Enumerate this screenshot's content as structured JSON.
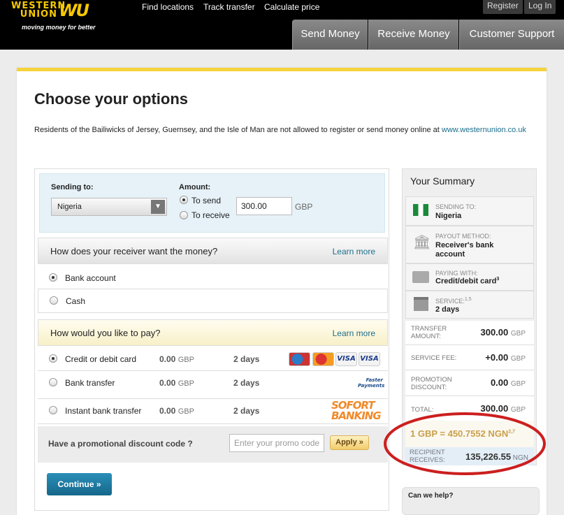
{
  "header": {
    "logo_line1": "WESTERN",
    "logo_line2": "UNION",
    "logo_mark": "WU",
    "tagline": "moving money for better",
    "links": [
      "Find locations",
      "Track transfer",
      "Calculate price"
    ],
    "register": "Register",
    "login": "Log In",
    "tabs": [
      "Send Money",
      "Receive Money",
      "Customer Support"
    ]
  },
  "page": {
    "title": "Choose your options",
    "notice": "Residents of the Bailiwicks of Jersey, Guernsey, and the Isle of Man are not allowed to register or send money online at ",
    "notice_link": "www.westernunion.co.uk"
  },
  "sending": {
    "label": "Sending to:",
    "country": "Nigeria",
    "amount_label": "Amount:",
    "to_send": "To send",
    "to_receive": "To receive",
    "amount": "300.00",
    "currency": "GBP",
    "selected": "To send"
  },
  "receive": {
    "question": "How does your receiver want the money?",
    "learn_more": "Learn more",
    "options": [
      "Bank account",
      "Cash"
    ],
    "selected": "Bank account"
  },
  "pay": {
    "question": "How would you like to pay?",
    "learn_more": "Learn more",
    "selected": "Credit or debit card",
    "options": [
      {
        "label": "Credit or debit card",
        "fee": "0.00",
        "currency": "GBP",
        "days": "2 days",
        "logos": [
          "Maestro",
          "MasterCard",
          "VISA",
          "VISA"
        ]
      },
      {
        "label": "Bank transfer",
        "fee": "0.00",
        "currency": "GBP",
        "days": "2 days",
        "logos": [
          "Faster Payments"
        ]
      },
      {
        "label": "Instant bank transfer",
        "fee": "0.00",
        "currency": "GBP",
        "days": "2 days",
        "logos": [
          "SOFORT BANKING"
        ]
      }
    ]
  },
  "promo": {
    "label": "Have a promotional discount code ?",
    "placeholder": "Enter your promo code",
    "apply": "Apply »"
  },
  "continue": "Continue »",
  "summary": {
    "title": "Your Summary",
    "sending_to_label": "SENDING TO:",
    "sending_to": "Nigeria",
    "payout_label": "PAYOUT METHOD:",
    "payout": "Receiver's bank account",
    "paying_label": "PAYING WITH:",
    "paying": "Credit/debit card",
    "paying_sup": "3",
    "service_label": "SERVICE:",
    "service_sup": "1,5",
    "service": "2 days",
    "transfer_label": "TRANSFER AMOUNT:",
    "transfer": "300.00",
    "fee_label": "SERVICE FEE:",
    "fee": "+0.00",
    "discount_label": "PROMOTION DISCOUNT:",
    "discount": "0.00",
    "total_label": "TOTAL:",
    "total": "300.00",
    "currency": "GBP",
    "rate": "1 GBP = 450.7552 NGN",
    "rate_sup": "2,7",
    "recipient_label": "RECIPIENT RECEIVES:",
    "recipient": "135,226.55",
    "recipient_currency": "NGN"
  },
  "help": {
    "title": "Can we help?"
  },
  "colors": {
    "brand_yellow": "#f5c800",
    "link": "#1b6e8c",
    "annotation": "#cc1f1f",
    "rate": "#c9a04a"
  }
}
